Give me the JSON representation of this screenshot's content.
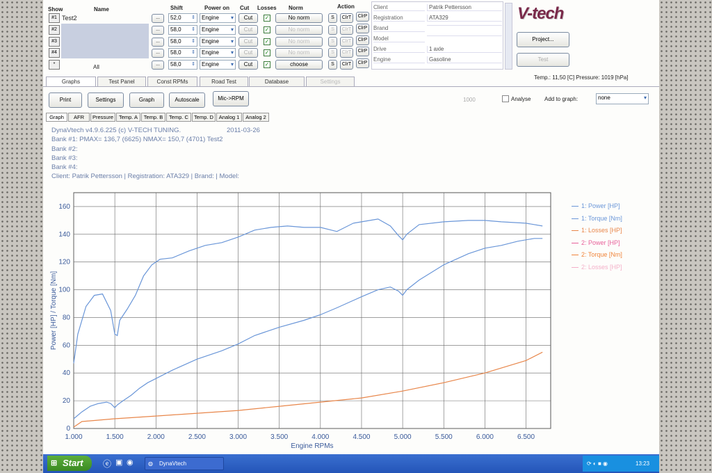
{
  "toolbar": {
    "show": "Show",
    "name": "Name",
    "shift": "Shift",
    "power_on": "Power on",
    "cut": "Cut",
    "losses": "Losses",
    "norm": "Norm",
    "action": "Action",
    "rows": [
      {
        "id": "#1",
        "name": "Test2",
        "shift": "52,0",
        "power": "Engine",
        "cut": "Cut",
        "norm": "No norm"
      },
      {
        "id": "#2",
        "name": "",
        "shift": "58,0",
        "power": "Engine",
        "cut": "Cut",
        "norm": "No norm"
      },
      {
        "id": "#3",
        "name": "",
        "shift": "58,0",
        "power": "Engine",
        "cut": "Cut",
        "norm": "No norm"
      },
      {
        "id": "#4",
        "name": "",
        "shift": "58,0",
        "power": "Engine",
        "cut": "Cut",
        "norm": "No norm"
      },
      {
        "id": "*",
        "name": "All",
        "shift": "58,0",
        "power": "Engine",
        "cut": "Cut",
        "norm": "choose"
      }
    ],
    "browse": "...",
    "s": "S",
    "clrt": "ClrT",
    "clrp": "ClrP"
  },
  "client": [
    {
      "label": "Client",
      "value": "Patrik Pettersson"
    },
    {
      "label": "Registration",
      "value": "ATA329"
    },
    {
      "label": "Brand",
      "value": ""
    },
    {
      "label": "Model",
      "value": ""
    },
    {
      "label": "Drive",
      "value": "1 axle"
    },
    {
      "label": "Engine",
      "value": "Gasoline"
    }
  ],
  "logo": "V-tech",
  "project_button": "Project...",
  "test_button": "Test",
  "status": "Temp.: 11,50 [C]  Pressure: 1019 [hPa]",
  "tabs": [
    "Graphs",
    "Test Panel",
    "Const RPMs",
    "Road Test",
    "Database",
    "Settings"
  ],
  "graph_toolbar": {
    "print": "Print",
    "settings": "Settings",
    "graph": "Graph",
    "autoscale": "Autoscale",
    "mic": "Mic->RPM",
    "rpm_value": "1000",
    "analyse": "Analyse",
    "add_to_graph": "Add to graph:",
    "none": "none"
  },
  "subtabs": [
    "Graph",
    "AFR",
    "Pressure",
    "Temp. A",
    "Temp. B",
    "Temp. C",
    "Temp. D",
    "Analog 1",
    "Analog 2"
  ],
  "info": {
    "line1": "DynaVtech v4.9.6.225 (c) V-TECH TUNING.",
    "date": "2011-03-26",
    "line2": "Bank #1: PMAX= 136,7 (6625)      NMAX= 150,7 (4701)    Test2",
    "line3": "Bank #2:",
    "line4": "Bank #3:",
    "line5": "Bank #4:",
    "line6": "Client: Patrik Pettersson | Registration: ATA329 | Brand:  | Model:"
  },
  "taskbar": {
    "start": "Start",
    "task": "DynaVtech",
    "clock": "13:23"
  },
  "chart_data": {
    "type": "line",
    "xlabel": "Engine RPMs",
    "ylabel": "Power [HP] / Torque [Nm]",
    "xlim": [
      1000,
      6800
    ],
    "ylim": [
      0,
      170
    ],
    "xticks": [
      "1.000",
      "1.500",
      "2.000",
      "2.500",
      "3.000",
      "3.500",
      "4.000",
      "4.500",
      "5.000",
      "5.500",
      "6.000",
      "6.500"
    ],
    "yticks": [
      "0",
      "20",
      "40",
      "60",
      "80",
      "100",
      "120",
      "140",
      "160"
    ],
    "grid": true,
    "legend_position": "right",
    "series": [
      {
        "name": "1: Power [HP]",
        "color": "#6a96d8",
        "x": [
          1000,
          1100,
          1200,
          1300,
          1400,
          1450,
          1500,
          1530,
          1600,
          1700,
          1800,
          1900,
          2000,
          2200,
          2500,
          2800,
          3000,
          3200,
          3500,
          3800,
          4000,
          4200,
          4500,
          4700,
          4850,
          4950,
          5000,
          5050,
          5200,
          5500,
          5800,
          6000,
          6200,
          6400,
          6600,
          6700
        ],
        "y": [
          7,
          12,
          16,
          18,
          19,
          18,
          15,
          17,
          20,
          24,
          29,
          33,
          36,
          42,
          50,
          56,
          61,
          67,
          73,
          78,
          82,
          87,
          95,
          100,
          102,
          99,
          96,
          100,
          107,
          118,
          126,
          130,
          132,
          135,
          137,
          137
        ]
      },
      {
        "name": "1: Torque [Nm]",
        "color": "#6a96d8",
        "x": [
          1000,
          1050,
          1150,
          1250,
          1350,
          1450,
          1500,
          1530,
          1560,
          1650,
          1750,
          1850,
          1950,
          2050,
          2200,
          2400,
          2600,
          2800,
          3000,
          3200,
          3400,
          3600,
          3800,
          4000,
          4200,
          4400,
          4600,
          4701,
          4850,
          4950,
          5000,
          5050,
          5200,
          5500,
          5800,
          6000,
          6200,
          6500,
          6700
        ],
        "y": [
          47,
          68,
          88,
          96,
          97,
          85,
          68,
          67,
          78,
          86,
          96,
          110,
          118,
          122,
          123,
          128,
          132,
          134,
          138,
          143,
          145,
          146,
          145,
          145,
          142,
          148,
          150,
          151,
          146,
          139,
          136,
          140,
          147,
          149,
          150,
          150,
          149,
          148,
          146
        ]
      },
      {
        "name": "1: Losses [HP]",
        "color": "#e8864a",
        "x": [
          1000,
          1100,
          1500,
          2000,
          2500,
          3000,
          3500,
          4000,
          4500,
          5000,
          5500,
          6000,
          6500,
          6700
        ],
        "y": [
          1,
          5,
          7,
          9,
          11,
          13,
          16,
          19,
          22,
          27,
          33,
          40,
          49,
          55
        ]
      },
      {
        "name": "2: Power [HP]",
        "color": "#e8609a",
        "x": [],
        "y": []
      },
      {
        "name": "2: Torque [Nm]",
        "color": "#f0843a",
        "x": [],
        "y": []
      },
      {
        "name": "2: Losses [HP]",
        "color": "#f4b0c8",
        "x": [],
        "y": []
      }
    ]
  }
}
